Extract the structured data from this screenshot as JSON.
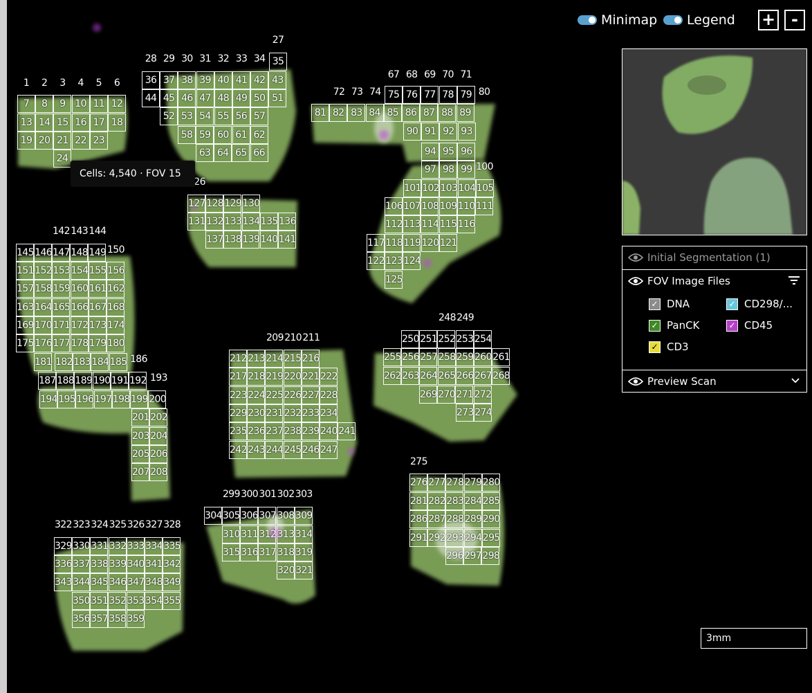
{
  "toolbar": {
    "minimap_label": "Minimap",
    "legend_label": "Legend",
    "zoom_in_label": "+",
    "zoom_out_label": "-"
  },
  "tooltip": {
    "text": "Cells: 4,540 · FOV 15"
  },
  "fov_labels": [
    "1",
    "2",
    "3",
    "4",
    "5",
    "6",
    "7",
    "8",
    "9",
    "10",
    "11",
    "12",
    "13",
    "14",
    "15",
    "16",
    "17",
    "18",
    "19",
    "20",
    "21",
    "22",
    "23",
    "24",
    "27",
    "28",
    "29",
    "30",
    "31",
    "32",
    "33",
    "34",
    "35",
    "36",
    "37",
    "38",
    "39",
    "40",
    "41",
    "42",
    "43",
    "44",
    "45",
    "46",
    "47",
    "48",
    "49",
    "50",
    "51",
    "52",
    "53",
    "54",
    "55",
    "56",
    "57",
    "58",
    "59",
    "60",
    "61",
    "62",
    "63",
    "64",
    "65",
    "66",
    "67",
    "68",
    "69",
    "70",
    "71",
    "72",
    "73",
    "74",
    "75",
    "76",
    "77",
    "78",
    "79",
    "80",
    "81",
    "82",
    "83",
    "84",
    "85",
    "86",
    "87",
    "88",
    "89",
    "90",
    "91",
    "92",
    "93",
    "94",
    "95",
    "96",
    "97",
    "98",
    "99",
    "100",
    "101",
    "102",
    "103",
    "104",
    "105",
    "106",
    "107",
    "108",
    "109",
    "110",
    "111",
    "112",
    "113",
    "114",
    "115",
    "116",
    "117",
    "118",
    "119",
    "120",
    "121",
    "122",
    "123",
    "124",
    "125",
    "126",
    "127",
    "128",
    "129",
    "130",
    "131",
    "132",
    "133",
    "134",
    "135",
    "136",
    "137",
    "138",
    "139",
    "140",
    "141",
    "142",
    "143",
    "144",
    "145",
    "146",
    "147",
    "148",
    "149",
    "150",
    "151",
    "152",
    "153",
    "154",
    "155",
    "156",
    "157",
    "158",
    "159",
    "160",
    "161",
    "162",
    "163",
    "164",
    "165",
    "166",
    "167",
    "168",
    "169",
    "170",
    "171",
    "172",
    "173",
    "174",
    "175",
    "176",
    "177",
    "178",
    "179",
    "180",
    "181",
    "182",
    "183",
    "184",
    "185",
    "186",
    "187",
    "188",
    "189",
    "190",
    "191",
    "192",
    "193",
    "194",
    "195",
    "196",
    "197",
    "198",
    "199",
    "200",
    "201",
    "202",
    "203",
    "204",
    "205",
    "206",
    "207",
    "208",
    "209",
    "210",
    "211",
    "212",
    "213",
    "214",
    "215",
    "216",
    "217",
    "218",
    "219",
    "220",
    "221",
    "222",
    "223",
    "224",
    "225",
    "226",
    "227",
    "228",
    "229",
    "230",
    "231",
    "232",
    "233",
    "234",
    "235",
    "236",
    "237",
    "238",
    "239",
    "240",
    "241",
    "242",
    "243",
    "244",
    "245",
    "246",
    "247",
    "248",
    "249",
    "250",
    "251",
    "252",
    "253",
    "254",
    "255",
    "256",
    "257",
    "258",
    "259",
    "260",
    "261",
    "262",
    "263",
    "264",
    "265",
    "266",
    "267",
    "268",
    "269",
    "270",
    "271",
    "272",
    "273",
    "274",
    "275",
    "276",
    "277",
    "278",
    "279",
    "280",
    "281",
    "282",
    "283",
    "284",
    "285",
    "286",
    "287",
    "288",
    "289",
    "290",
    "291",
    "292",
    "293",
    "294",
    "295",
    "296",
    "297",
    "298",
    "299",
    "300",
    "301",
    "302",
    "303",
    "304",
    "305",
    "306",
    "307",
    "308",
    "309",
    "310",
    "311",
    "312",
    "313",
    "314",
    "315",
    "316",
    "317",
    "318",
    "319",
    "320",
    "321",
    "322",
    "323",
    "324",
    "325",
    "326",
    "327",
    "328",
    "329",
    "330",
    "331",
    "332",
    "333",
    "334",
    "335",
    "336",
    "337",
    "338",
    "339",
    "340",
    "341",
    "342",
    "343",
    "344",
    "345",
    "346",
    "347",
    "348",
    "349",
    "350",
    "351",
    "352",
    "353",
    "354",
    "355",
    "356",
    "357",
    "358",
    "359"
  ],
  "layers": {
    "initial_segmentation": "Initial Segmentation (1)",
    "fov_image_files": "FOV Image Files",
    "preview_scan": "Preview Scan",
    "channels": [
      {
        "name": "DNA",
        "color": "#8c8c8c",
        "checked": true
      },
      {
        "name": "CD298/...",
        "color": "#66c6dc",
        "checked": true
      },
      {
        "name": "PanCK",
        "color": "#3f8a26",
        "checked": true
      },
      {
        "name": "CD45",
        "color": "#b640c8",
        "checked": true
      },
      {
        "name": "CD3",
        "color": "#e8dc3c",
        "checked": true
      }
    ]
  },
  "scale_bar": {
    "label": "3mm"
  },
  "colors": {
    "tissue_green": "#9ed06a",
    "accent_blue": "#5aa0cf",
    "marker_magenta": "#c040e0"
  }
}
